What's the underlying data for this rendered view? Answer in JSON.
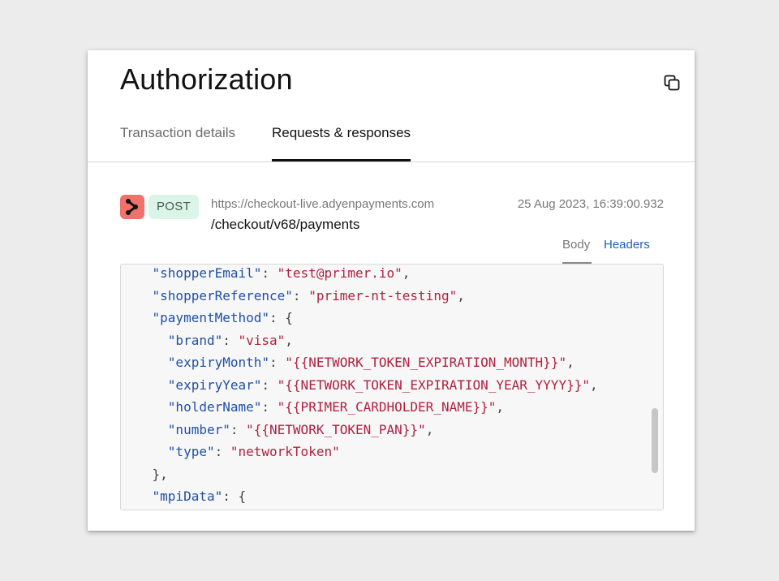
{
  "panel": {
    "title": "Authorization",
    "copy_icon": "copy-icon"
  },
  "tabs": [
    {
      "label": "Transaction details",
      "active": false
    },
    {
      "label": "Requests & responses",
      "active": true
    }
  ],
  "request": {
    "vendor_icon": "adyen-logo-icon",
    "method": "POST",
    "host": "https://checkout-live.adyenpayments.com",
    "path": "/checkout/v68/payments",
    "timestamp": "25 Aug 2023, 16:39:00.932"
  },
  "subtabs": [
    {
      "label": "Body",
      "active": true
    },
    {
      "label": "Headers",
      "active": false
    }
  ],
  "code_lines": [
    {
      "indent": 4,
      "key": "\"shopperEmail\"",
      "sep": ": ",
      "value": "\"test@primer.io\"",
      "tail": ","
    },
    {
      "indent": 4,
      "key": "\"shopperReference\"",
      "sep": ": ",
      "value": "\"primer-nt-testing\"",
      "tail": ","
    },
    {
      "indent": 4,
      "key": "\"paymentMethod\"",
      "sep": ": ",
      "value": "",
      "tail": "{"
    },
    {
      "indent": 6,
      "key": "\"brand\"",
      "sep": ": ",
      "value": "\"visa\"",
      "tail": ","
    },
    {
      "indent": 6,
      "key": "\"expiryMonth\"",
      "sep": ": ",
      "value": "\"{{NETWORK_TOKEN_EXPIRATION_MONTH}}\"",
      "tail": ","
    },
    {
      "indent": 6,
      "key": "\"expiryYear\"",
      "sep": ": ",
      "value": "\"{{NETWORK_TOKEN_EXPIRATION_YEAR_YYYY}}\"",
      "tail": ","
    },
    {
      "indent": 6,
      "key": "\"holderName\"",
      "sep": ": ",
      "value": "\"{{PRIMER_CARDHOLDER_NAME}}\"",
      "tail": ","
    },
    {
      "indent": 6,
      "key": "\"number\"",
      "sep": ": ",
      "value": "\"{{NETWORK_TOKEN_PAN}}\"",
      "tail": ","
    },
    {
      "indent": 6,
      "key": "\"type\"",
      "sep": ": ",
      "value": "\"networkToken\"",
      "tail": ""
    },
    {
      "indent": 4,
      "key": "",
      "sep": "",
      "value": "",
      "tail": "},"
    },
    {
      "indent": 4,
      "key": "\"mpiData\"",
      "sep": ": ",
      "value": "",
      "tail": "{"
    }
  ],
  "colors": {
    "json_key": "#1f4fa6",
    "json_string": "#b0213f",
    "method_badge_bg": "#daf5e8",
    "vendor_logo_bg": "#f0726a",
    "link_blue": "#1e5fb8"
  }
}
